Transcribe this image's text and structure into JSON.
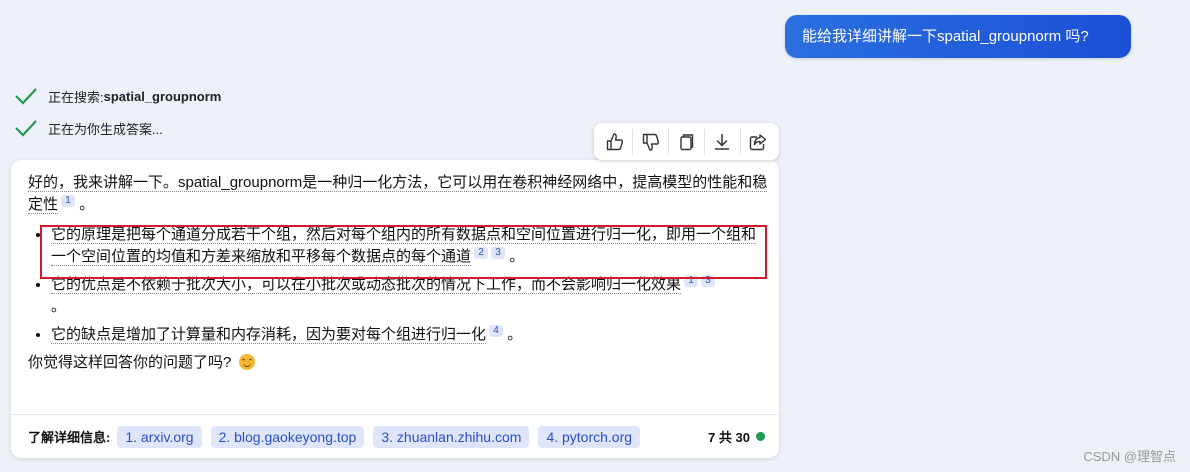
{
  "user_message": "能给我详细讲解一下spatial_groupnorm 吗?",
  "status": [
    {
      "prefix": "正在搜索: ",
      "bold": "spatial_groupnorm",
      "icon": "check-icon"
    },
    {
      "prefix": "正在为你生成答案...",
      "bold": "",
      "icon": "check-icon"
    }
  ],
  "toolbar": {
    "buttons": [
      "thumbs-up-icon",
      "thumbs-down-icon",
      "copy-icon",
      "download-icon",
      "share-icon"
    ]
  },
  "answer": {
    "intro": "好的，我来讲解一下。spatial_groupnorm是一种归一化方法，它可以用在卷积神经网络中，提高模型的性能和稳定性",
    "intro_refs": [
      "1"
    ],
    "intro_end": "。",
    "bullets": [
      {
        "text": "它的原理是把每个通道分成若干个组，然后对每个组内的所有数据点和空间位置进行归一化，即用一个组和一个空间位置的均值和方差来缩放和平移每个数据点的每个通道",
        "refs": [
          "2",
          "3"
        ],
        "end": "。"
      },
      {
        "text": "它的优点是不依赖于批次大小，可以在小批次或动态批次的情况下工作，而不会影响归一化效果",
        "refs": [
          "1",
          "3"
        ],
        "end": "。"
      },
      {
        "text": "它的缺点是增加了计算量和内存消耗，因为要对每个组进行归一化",
        "refs": [
          "4"
        ],
        "end": "。"
      }
    ],
    "closing": "你觉得这样回答你的问题了吗?"
  },
  "footer": {
    "label": "了解详细信息:",
    "sources": [
      "1. arxiv.org",
      "2. blog.gaokeyong.top",
      "3. zhuanlan.zhihu.com",
      "4. pytorch.org"
    ],
    "count": "7 共 30",
    "status_color": "#1f9b4f"
  },
  "watermark": "CSDN @理智点",
  "colors": {
    "accent": "#1b4fd6",
    "highlight_border": "#d11a2a",
    "ref_bg": "#dfe6fb"
  }
}
